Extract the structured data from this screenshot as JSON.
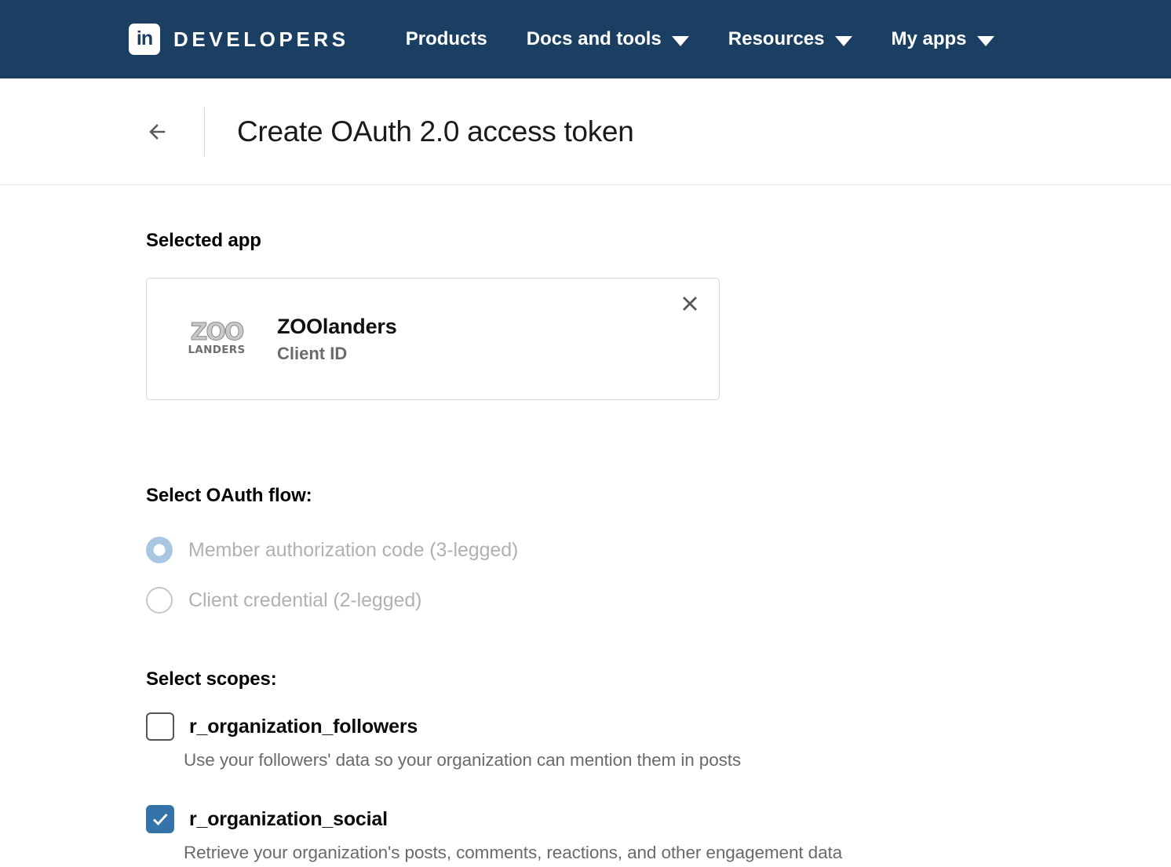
{
  "navbar": {
    "logo_text": "in",
    "brand": "DEVELOPERS",
    "items": [
      {
        "label": "Products",
        "has_dropdown": false
      },
      {
        "label": "Docs and tools",
        "has_dropdown": true
      },
      {
        "label": "Resources",
        "has_dropdown": true
      },
      {
        "label": "My apps",
        "has_dropdown": true
      }
    ],
    "background_color": "#1b3f63"
  },
  "header": {
    "back_icon": "arrow-left-icon",
    "title": "Create OAuth 2.0 access token"
  },
  "selected_app": {
    "label": "Selected app",
    "close_icon": "close-icon",
    "logo": {
      "primary": "ZOO",
      "secondary": "LANDERS"
    },
    "name": "ZOOlanders",
    "client_id_label": "Client ID",
    "client_id_value": ""
  },
  "oauth_flow": {
    "label": "Select OAuth flow:",
    "options": [
      {
        "label": "Member authorization code (3-legged)",
        "selected": true,
        "disabled": true
      },
      {
        "label": "Client credential (2-legged)",
        "selected": false,
        "disabled": true
      }
    ]
  },
  "scopes": {
    "label": "Select scopes:",
    "items": [
      {
        "name": "r_organization_followers",
        "description": "Use your followers' data so your organization can mention them in posts",
        "checked": false
      },
      {
        "name": "r_organization_social",
        "description": "Retrieve your organization's posts, comments, reactions, and other engagement data",
        "checked": true
      }
    ]
  },
  "colors": {
    "navy": "#1b3f63",
    "checkbox_blue": "#3574ab",
    "radio_blue": "#a9c7e2"
  }
}
